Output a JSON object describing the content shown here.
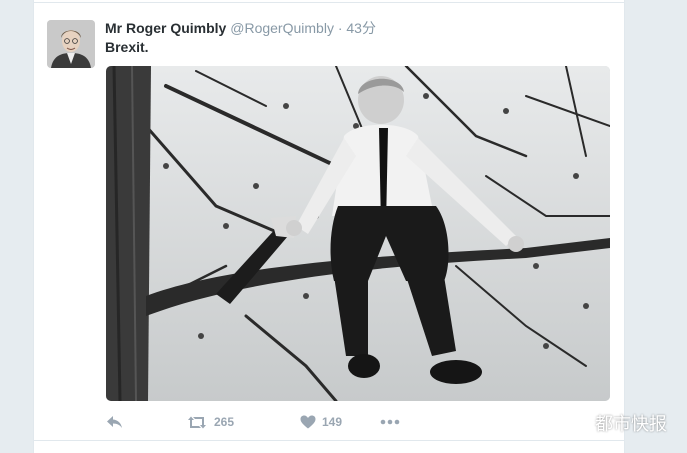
{
  "tweet": {
    "display_name": "Mr Roger Quimbly",
    "handle": "@RogerQuimbly",
    "separator": "·",
    "time": "43分",
    "text": "Brexit."
  },
  "actions": {
    "reply_icon": "reply-icon",
    "retweet_icon": "retweet-icon",
    "retweet_count": "265",
    "like_icon": "heart-icon",
    "like_count": "149",
    "more_icon": "more-icon"
  },
  "watermark": {
    "text": "都市快报",
    "icon": "wechat-icon"
  },
  "colors": {
    "name": "#292f33",
    "meta": "#8899a6",
    "action": "#9aa6b2",
    "background": "#e6ecf0",
    "card": "#ffffff"
  }
}
